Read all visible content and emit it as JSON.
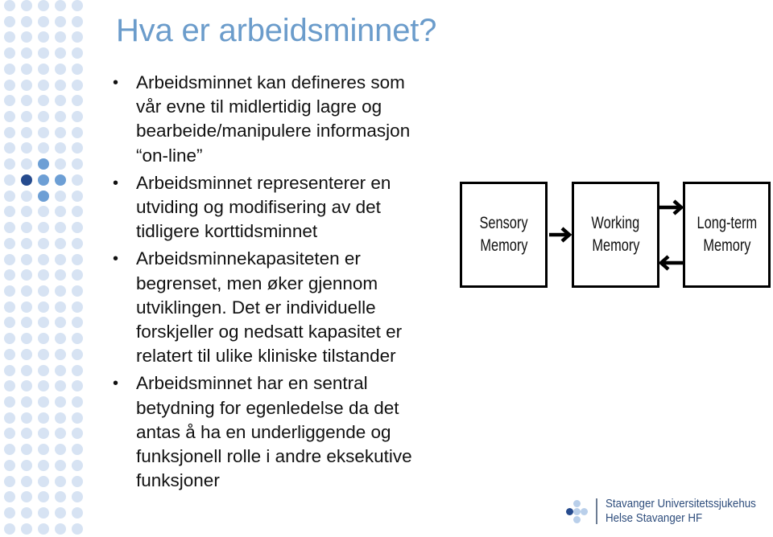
{
  "slide": {
    "title": "Hva er arbeidsminnet?",
    "bullets": [
      {
        "lines": [
          "Arbeidsminnet kan defineres som",
          "vår evne til midlertidig lagre og",
          "bearbeide/manipulere informasjon",
          "“on-line”"
        ]
      },
      {
        "lines": [
          "Arbeidsminnet representerer en",
          "utviding og modifisering av det",
          "tidligere korttidsminnet"
        ]
      },
      {
        "lines": [
          "Arbeidsminnekapasiteten er",
          "begrenset, men øker gjennom",
          "utviklingen. Det er individuelle",
          "forskjeller og nedsatt kapasitet er",
          "relatert til ulike kliniske tilstander"
        ]
      },
      {
        "lines": [
          "Arbeidsminnet har en sentral",
          "betydning for egenledelse da det",
          "antas å ha en underliggende og",
          "funksjonell rolle i andre eksekutive",
          "funksjoner"
        ]
      }
    ],
    "bullet_symbol": "•"
  },
  "diagram": {
    "nodes": [
      {
        "id": "sensory",
        "line1": "Sensory",
        "line2": "Memory"
      },
      {
        "id": "working",
        "line1": "Working",
        "line2": "Memory"
      },
      {
        "id": "longterm",
        "line1": "Long-term",
        "line2": "Memory"
      }
    ],
    "edges": [
      {
        "from": "sensory",
        "to": "working"
      },
      {
        "from": "working",
        "to": "longterm"
      },
      {
        "from": "longterm",
        "to": "working"
      }
    ]
  },
  "logo": {
    "line1": "Stavanger Universitetssjukehus",
    "line2": "Helse Stavanger HF"
  },
  "decoration": {
    "dot_grid": {
      "columns": 5,
      "rows": 34,
      "highlights": [
        {
          "row": 10,
          "col": 2,
          "shade": "medium"
        },
        {
          "row": 11,
          "col": 1,
          "shade": "dark"
        },
        {
          "row": 11,
          "col": 2,
          "shade": "medium"
        },
        {
          "row": 11,
          "col": 3,
          "shade": "medium"
        },
        {
          "row": 12,
          "col": 2,
          "shade": "medium"
        }
      ]
    }
  },
  "colors": {
    "title": "#6b9ccb",
    "dot_light": "#d7e3f3",
    "dot_medium": "#6d9fd5",
    "dot_dark": "#264b8e",
    "logo_text": "#2e4d7c"
  }
}
